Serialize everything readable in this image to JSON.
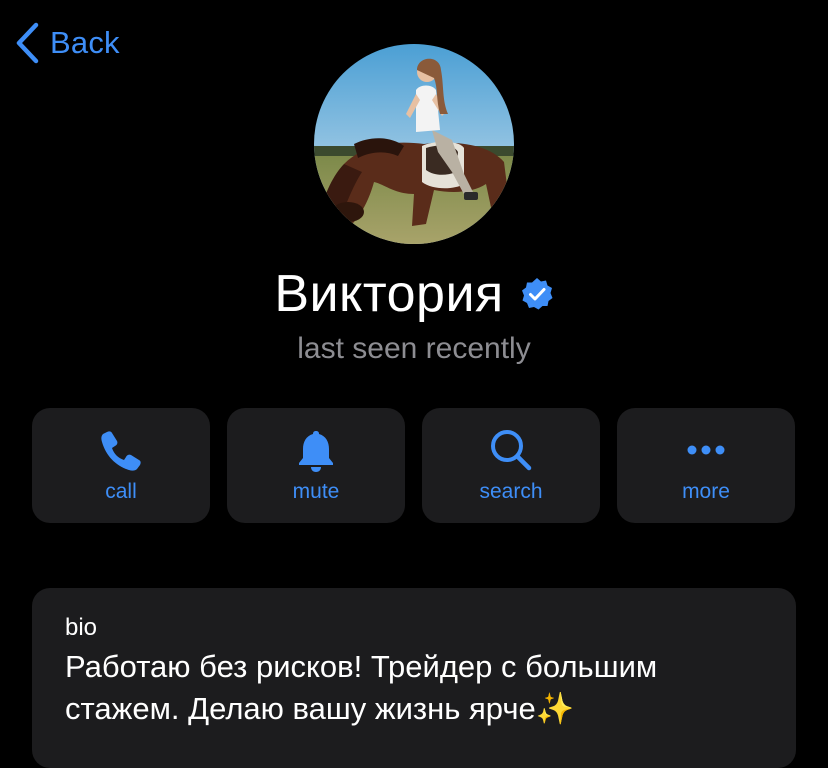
{
  "nav": {
    "back_label": "Back",
    "back_icon": "chevron-left-icon",
    "accent_color": "#3e8ef7"
  },
  "profile": {
    "name": "Виктория",
    "verified": true,
    "verified_icon": "verified-badge-icon",
    "verified_color": "#3e8ef7",
    "status": "last seen recently",
    "avatar_description_icon": "avatar-photo"
  },
  "actions": [
    {
      "label": "call",
      "icon": "phone-icon"
    },
    {
      "label": "mute",
      "icon": "bell-icon"
    },
    {
      "label": "search",
      "icon": "search-icon"
    },
    {
      "label": "more",
      "icon": "more-dots-icon"
    }
  ],
  "bio": {
    "title": "bio",
    "text": "Работаю без рисков! Трейдер с большим стажем. Делаю вашу жизнь ярче",
    "emoji": "✨"
  },
  "colors": {
    "background": "#000000",
    "card": "#1c1c1e",
    "secondary_text": "#8d8d92"
  }
}
